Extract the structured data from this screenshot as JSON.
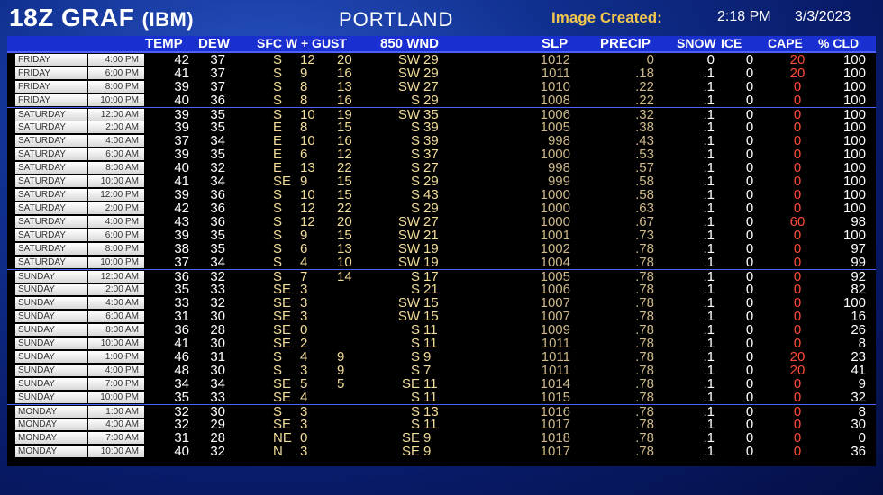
{
  "header": {
    "title": "18Z GRAF",
    "subtitle": "(IBM)",
    "location": "PORTLAND",
    "created_label": "Image Created:",
    "created_time": "2:18 PM",
    "created_date": "3/3/2023"
  },
  "columns": {
    "temp": "TEMP",
    "dew": "DEW",
    "sfc": "SFC W + GUST",
    "wnd850": "850 WND",
    "slp": "SLP",
    "precip": "PRECIP",
    "snow": "SNOW",
    "ice": "ICE",
    "cape": "CAPE",
    "cld": "% CLD"
  },
  "colors": {
    "header_bar": "#1a2fd0",
    "title_accent": "#f3c64f",
    "cape_red": "#ff4a3a",
    "wind_yellow": "#f2dd9a"
  },
  "rows": [
    {
      "day": "FRIDAY",
      "time": "4:00 PM",
      "temp": "42",
      "dew": "37",
      "sdir": "S",
      "sspd": "12",
      "gust": "20",
      "udir": "SW",
      "uspd": "29",
      "slp": "1012",
      "precip": "0",
      "snow": "0",
      "ice": "0",
      "cape": "20",
      "cld": "100"
    },
    {
      "day": "FRIDAY",
      "time": "6:00 PM",
      "temp": "41",
      "dew": "37",
      "sdir": "S",
      "sspd": "9",
      "gust": "16",
      "udir": "SW",
      "uspd": "29",
      "slp": "1011",
      "precip": ".18",
      "snow": ".1",
      "ice": "0",
      "cape": "20",
      "cld": "100"
    },
    {
      "day": "FRIDAY",
      "time": "8:00 PM",
      "temp": "39",
      "dew": "37",
      "sdir": "S",
      "sspd": "8",
      "gust": "13",
      "udir": "SW",
      "uspd": "27",
      "slp": "1010",
      "precip": ".22",
      "snow": ".1",
      "ice": "0",
      "cape": "0",
      "cld": "100"
    },
    {
      "day": "FRIDAY",
      "time": "10:00 PM",
      "temp": "40",
      "dew": "36",
      "sdir": "S",
      "sspd": "8",
      "gust": "16",
      "udir": "S",
      "uspd": "29",
      "slp": "1008",
      "precip": ".22",
      "snow": ".1",
      "ice": "0",
      "cape": "0",
      "cld": "100"
    },
    {
      "day": "SATURDAY",
      "time": "12:00 AM",
      "temp": "39",
      "dew": "35",
      "sdir": "S",
      "sspd": "10",
      "gust": "19",
      "udir": "SW",
      "uspd": "35",
      "slp": "1006",
      "precip": ".32",
      "snow": ".1",
      "ice": "0",
      "cape": "0",
      "cld": "100"
    },
    {
      "day": "SATURDAY",
      "time": "2:00 AM",
      "temp": "39",
      "dew": "35",
      "sdir": "E",
      "sspd": "8",
      "gust": "15",
      "udir": "S",
      "uspd": "39",
      "slp": "1005",
      "precip": ".38",
      "snow": ".1",
      "ice": "0",
      "cape": "0",
      "cld": "100"
    },
    {
      "day": "SATURDAY",
      "time": "4:00 AM",
      "temp": "37",
      "dew": "34",
      "sdir": "E",
      "sspd": "10",
      "gust": "16",
      "udir": "S",
      "uspd": "39",
      "slp": "998",
      "precip": ".43",
      "snow": ".1",
      "ice": "0",
      "cape": "0",
      "cld": "100"
    },
    {
      "day": "SATURDAY",
      "time": "6:00 AM",
      "temp": "39",
      "dew": "35",
      "sdir": "E",
      "sspd": "6",
      "gust": "12",
      "udir": "S",
      "uspd": "37",
      "slp": "1000",
      "precip": ".53",
      "snow": ".1",
      "ice": "0",
      "cape": "0",
      "cld": "100"
    },
    {
      "day": "SATURDAY",
      "time": "8:00 AM",
      "temp": "40",
      "dew": "32",
      "sdir": "E",
      "sspd": "13",
      "gust": "22",
      "udir": "S",
      "uspd": "27",
      "slp": "998",
      "precip": ".57",
      "snow": ".1",
      "ice": "0",
      "cape": "0",
      "cld": "100"
    },
    {
      "day": "SATURDAY",
      "time": "10:00 AM",
      "temp": "41",
      "dew": "34",
      "sdir": "SE",
      "sspd": "9",
      "gust": "15",
      "udir": "S",
      "uspd": "29",
      "slp": "999",
      "precip": ".58",
      "snow": ".1",
      "ice": "0",
      "cape": "0",
      "cld": "100"
    },
    {
      "day": "SATURDAY",
      "time": "12:00 PM",
      "temp": "39",
      "dew": "36",
      "sdir": "S",
      "sspd": "10",
      "gust": "15",
      "udir": "S",
      "uspd": "43",
      "slp": "1000",
      "precip": ".58",
      "snow": ".1",
      "ice": "0",
      "cape": "0",
      "cld": "100"
    },
    {
      "day": "SATURDAY",
      "time": "2:00 PM",
      "temp": "42",
      "dew": "36",
      "sdir": "S",
      "sspd": "12",
      "gust": "22",
      "udir": "S",
      "uspd": "29",
      "slp": "1000",
      "precip": ".63",
      "snow": ".1",
      "ice": "0",
      "cape": "0",
      "cld": "100"
    },
    {
      "day": "SATURDAY",
      "time": "4:00 PM",
      "temp": "43",
      "dew": "36",
      "sdir": "S",
      "sspd": "12",
      "gust": "20",
      "udir": "SW",
      "uspd": "27",
      "slp": "1000",
      "precip": ".67",
      "snow": ".1",
      "ice": "0",
      "cape": "60",
      "cld": "98"
    },
    {
      "day": "SATURDAY",
      "time": "6:00 PM",
      "temp": "39",
      "dew": "35",
      "sdir": "S",
      "sspd": "9",
      "gust": "15",
      "udir": "SW",
      "uspd": "21",
      "slp": "1001",
      "precip": ".73",
      "snow": ".1",
      "ice": "0",
      "cape": "0",
      "cld": "100"
    },
    {
      "day": "SATURDAY",
      "time": "8:00 PM",
      "temp": "38",
      "dew": "35",
      "sdir": "S",
      "sspd": "6",
      "gust": "13",
      "udir": "SW",
      "uspd": "19",
      "slp": "1002",
      "precip": ".78",
      "snow": ".1",
      "ice": "0",
      "cape": "0",
      "cld": "97"
    },
    {
      "day": "SATURDAY",
      "time": "10:00 PM",
      "temp": "37",
      "dew": "34",
      "sdir": "S",
      "sspd": "4",
      "gust": "10",
      "udir": "SW",
      "uspd": "19",
      "slp": "1004",
      "precip": ".78",
      "snow": ".1",
      "ice": "0",
      "cape": "0",
      "cld": "99"
    },
    {
      "day": "SUNDAY",
      "time": "12:00 AM",
      "temp": "36",
      "dew": "32",
      "sdir": "S",
      "sspd": "7",
      "gust": "14",
      "udir": "S",
      "uspd": "17",
      "slp": "1005",
      "precip": ".78",
      "snow": ".1",
      "ice": "0",
      "cape": "0",
      "cld": "92"
    },
    {
      "day": "SUNDAY",
      "time": "2:00 AM",
      "temp": "35",
      "dew": "33",
      "sdir": "SE",
      "sspd": "3",
      "gust": "",
      "udir": "S",
      "uspd": "21",
      "slp": "1006",
      "precip": ".78",
      "snow": ".1",
      "ice": "0",
      "cape": "0",
      "cld": "82"
    },
    {
      "day": "SUNDAY",
      "time": "4:00 AM",
      "temp": "33",
      "dew": "32",
      "sdir": "SE",
      "sspd": "3",
      "gust": "",
      "udir": "SW",
      "uspd": "15",
      "slp": "1007",
      "precip": ".78",
      "snow": ".1",
      "ice": "0",
      "cape": "0",
      "cld": "100"
    },
    {
      "day": "SUNDAY",
      "time": "6:00 AM",
      "temp": "31",
      "dew": "30",
      "sdir": "SE",
      "sspd": "3",
      "gust": "",
      "udir": "SW",
      "uspd": "15",
      "slp": "1007",
      "precip": ".78",
      "snow": ".1",
      "ice": "0",
      "cape": "0",
      "cld": "16"
    },
    {
      "day": "SUNDAY",
      "time": "8:00 AM",
      "temp": "36",
      "dew": "28",
      "sdir": "SE",
      "sspd": "0",
      "gust": "",
      "udir": "S",
      "uspd": "11",
      "slp": "1009",
      "precip": ".78",
      "snow": ".1",
      "ice": "0",
      "cape": "0",
      "cld": "26"
    },
    {
      "day": "SUNDAY",
      "time": "10:00 AM",
      "temp": "41",
      "dew": "30",
      "sdir": "SE",
      "sspd": "2",
      "gust": "",
      "udir": "S",
      "uspd": "11",
      "slp": "1011",
      "precip": ".78",
      "snow": ".1",
      "ice": "0",
      "cape": "0",
      "cld": "8"
    },
    {
      "day": "SUNDAY",
      "time": "1:00 PM",
      "temp": "46",
      "dew": "31",
      "sdir": "S",
      "sspd": "4",
      "gust": "9",
      "udir": "S",
      "uspd": "9",
      "slp": "1011",
      "precip": ".78",
      "snow": ".1",
      "ice": "0",
      "cape": "20",
      "cld": "23"
    },
    {
      "day": "SUNDAY",
      "time": "4:00 PM",
      "temp": "48",
      "dew": "30",
      "sdir": "S",
      "sspd": "3",
      "gust": "9",
      "udir": "S",
      "uspd": "7",
      "slp": "1011",
      "precip": ".78",
      "snow": ".1",
      "ice": "0",
      "cape": "20",
      "cld": "41"
    },
    {
      "day": "SUNDAY",
      "time": "7:00 PM",
      "temp": "34",
      "dew": "34",
      "sdir": "SE",
      "sspd": "5",
      "gust": "5",
      "udir": "SE",
      "uspd": "11",
      "slp": "1014",
      "precip": ".78",
      "snow": ".1",
      "ice": "0",
      "cape": "0",
      "cld": "9"
    },
    {
      "day": "SUNDAY",
      "time": "10:00 PM",
      "temp": "35",
      "dew": "33",
      "sdir": "SE",
      "sspd": "4",
      "gust": "",
      "udir": "S",
      "uspd": "11",
      "slp": "1015",
      "precip": ".78",
      "snow": ".1",
      "ice": "0",
      "cape": "0",
      "cld": "32"
    },
    {
      "day": "MONDAY",
      "time": "1:00 AM",
      "temp": "32",
      "dew": "30",
      "sdir": "S",
      "sspd": "3",
      "gust": "",
      "udir": "S",
      "uspd": "13",
      "slp": "1016",
      "precip": ".78",
      "snow": ".1",
      "ice": "0",
      "cape": "0",
      "cld": "8"
    },
    {
      "day": "MONDAY",
      "time": "4:00 AM",
      "temp": "32",
      "dew": "29",
      "sdir": "SE",
      "sspd": "3",
      "gust": "",
      "udir": "S",
      "uspd": "11",
      "slp": "1017",
      "precip": ".78",
      "snow": ".1",
      "ice": "0",
      "cape": "0",
      "cld": "30"
    },
    {
      "day": "MONDAY",
      "time": "7:00 AM",
      "temp": "31",
      "dew": "28",
      "sdir": "NE",
      "sspd": "0",
      "gust": "",
      "udir": "SE",
      "uspd": "9",
      "slp": "1018",
      "precip": ".78",
      "snow": ".1",
      "ice": "0",
      "cape": "0",
      "cld": "0"
    },
    {
      "day": "MONDAY",
      "time": "10:00 AM",
      "temp": "40",
      "dew": "32",
      "sdir": "N",
      "sspd": "3",
      "gust": "",
      "udir": "SE",
      "uspd": "9",
      "slp": "1017",
      "precip": ".78",
      "snow": ".1",
      "ice": "0",
      "cape": "0",
      "cld": "36"
    }
  ]
}
